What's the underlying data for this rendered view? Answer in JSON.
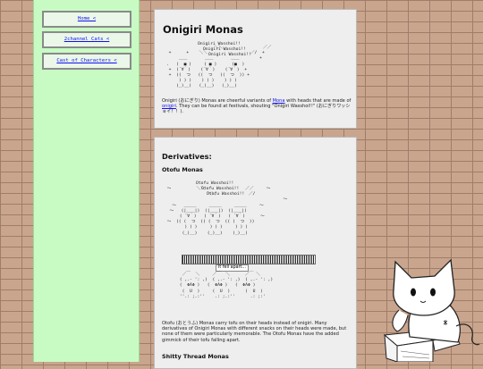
{
  "sidebar": {
    "items": [
      {
        "label": "Home <"
      },
      {
        "label": "2channel Cats <"
      },
      {
        "label": "Cast of Characters <"
      }
    ]
  },
  "intro": {
    "title": "Onigiri Monas",
    "shout1": "Onigiri Wasshoi!!",
    "shout2": "Onigiri Wasshoi!!",
    "shout3": "Onigiri Wasshoi!!",
    "text_before": "Onigiri (おにぎり) Monas are cheerful variants of ",
    "link_mona": "Mona",
    "text_mid": " with heads that are made of ",
    "link_onigiri": "onigiri",
    "text_after": ". They can be found at festivals, shouting \"Onigiri Wasshoi!!\" (おにぎりワッショイ！！)."
  },
  "derivatives": {
    "title": "Derivatives:",
    "otofu": {
      "title": "Otofu Monas",
      "shout1": "Otofu Wasshoi!!",
      "shout2": "Otofu Wasshoi!!",
      "shout3": "Otofu Wasshoi!!",
      "fell_text": "It fell apart...",
      "description": "Otofu (おとうふ) Monas carry tofu on their heads instead of onigiri. Many derivatives of Onigiri Monas with different snacks on their heads were made, but none of them were particularly memorable. The Otofu Monas have the added gimmick of their tofu falling apart."
    },
    "shitty": {
      "title": "Shitty Thread Monas"
    }
  }
}
